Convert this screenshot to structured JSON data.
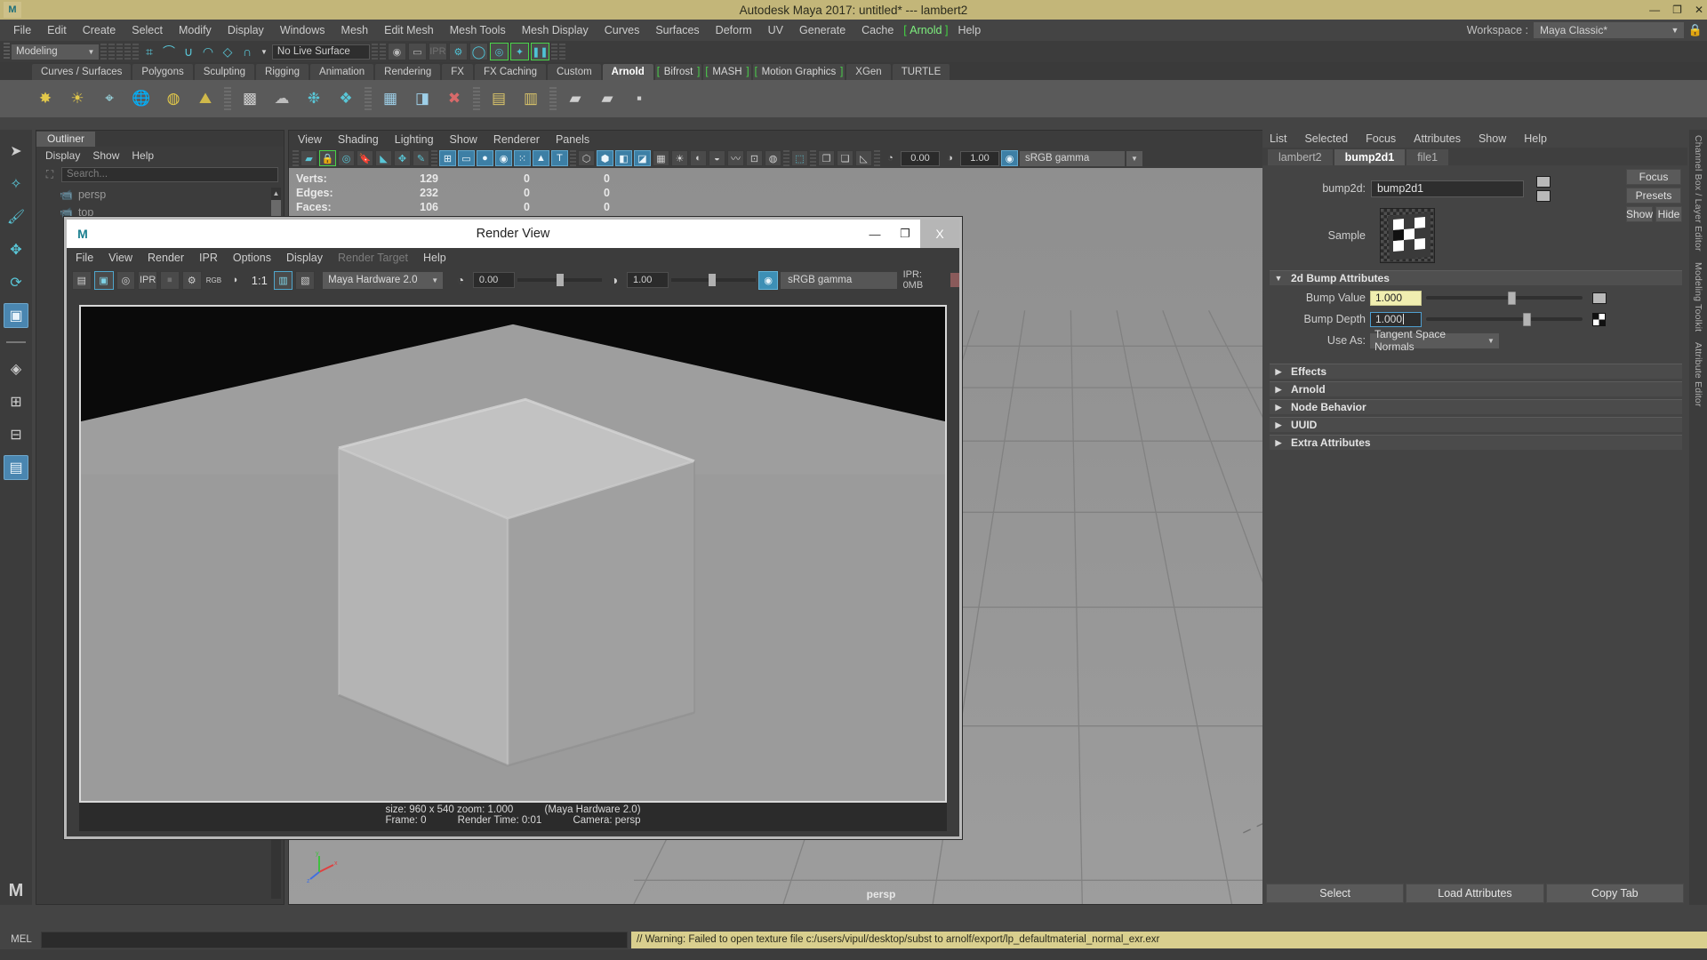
{
  "titlebar": {
    "title": "Autodesk Maya 2017: untitled*   ---   lambert2",
    "logo": "M",
    "minimize": "—",
    "maximize": "❐",
    "close": "✕"
  },
  "menubar": {
    "items": [
      "File",
      "Edit",
      "Create",
      "Select",
      "Modify",
      "Display",
      "Windows",
      "Mesh",
      "Edit Mesh",
      "Mesh Tools",
      "Mesh Display",
      "Curves",
      "Surfaces",
      "Deform",
      "UV",
      "Generate",
      "Cache",
      "Arnold",
      "Help"
    ],
    "highlighted": "Arnold",
    "workspace_label": "Workspace :",
    "workspace_value": "Maya Classic*",
    "lock_icon": "lock-icon"
  },
  "statusline": {
    "mode": "Modeling",
    "live_surface": "No Live Surface",
    "snap_icons": [
      "snap-grid-icon",
      "snap-curve-icon",
      "snap-point-icon",
      "snap-projected-center-icon",
      "snap-view-plane-icon",
      "snap-pivot-icon"
    ],
    "right_icons": [
      "render-current-frame-icon",
      "ipr-render-icon",
      "render-settings-icon",
      "hypershade-icon",
      "render-view-icon",
      "editor-icon",
      "playblast-icon"
    ]
  },
  "shelf": {
    "tabs": [
      {
        "label": "Curves / Surfaces",
        "style": "normal"
      },
      {
        "label": "Polygons",
        "style": "normal"
      },
      {
        "label": "Sculpting",
        "style": "normal"
      },
      {
        "label": "Rigging",
        "style": "normal"
      },
      {
        "label": "Animation",
        "style": "normal"
      },
      {
        "label": "Rendering",
        "style": "normal"
      },
      {
        "label": "FX",
        "style": "normal"
      },
      {
        "label": "FX Caching",
        "style": "normal"
      },
      {
        "label": "Custom",
        "style": "normal"
      },
      {
        "label": "Arnold",
        "style": "active"
      },
      {
        "label": "Bifrost",
        "style": "green"
      },
      {
        "label": "MASH",
        "style": "green"
      },
      {
        "label": "Motion Graphics",
        "style": "green"
      },
      {
        "label": "XGen",
        "style": "normal"
      },
      {
        "label": "TURTLE",
        "style": "normal"
      }
    ]
  },
  "toolbox": {
    "items": [
      {
        "name": "select-tool",
        "glyph": "➤",
        "state": "normal"
      },
      {
        "name": "lasso-select-tool",
        "glyph": "✎",
        "state": "normal"
      },
      {
        "name": "paint-select-tool",
        "glyph": "🖌",
        "state": "normal"
      },
      {
        "name": "move-tool",
        "glyph": "✥",
        "state": "normal"
      },
      {
        "name": "rotate-tool",
        "glyph": "⟳",
        "state": "normal"
      },
      {
        "name": "scale-tool",
        "glyph": "▣",
        "state": "selected"
      },
      {
        "name": "last-tool",
        "glyph": "◆",
        "state": "grey"
      },
      {
        "name": "single-perspective-layout",
        "glyph": "◈",
        "state": "grey"
      },
      {
        "name": "four-view-layout",
        "glyph": "⊞",
        "state": "grey"
      },
      {
        "name": "persp-outliner-layout",
        "glyph": "⊟",
        "state": "grey"
      },
      {
        "name": "hypergraph-layout",
        "glyph": "▤",
        "state": "selected"
      }
    ],
    "maya_mark": "M"
  },
  "outliner": {
    "tab_label": "Outliner",
    "menus": [
      "Display",
      "Show",
      "Help"
    ],
    "search_placeholder": "Search...",
    "search_icon": "search-filter-icon",
    "items": [
      {
        "label": "persp",
        "icon": "camera-icon"
      },
      {
        "label": "top",
        "icon": "camera-icon"
      }
    ]
  },
  "viewport": {
    "menus": [
      "View",
      "Shading",
      "Lighting",
      "Show",
      "Renderer",
      "Panels"
    ],
    "hud": {
      "rows": [
        {
          "label": "Verts:",
          "c1": "129",
          "c2": "0",
          "c3": "0"
        },
        {
          "label": "Edges:",
          "c1": "232",
          "c2": "0",
          "c3": "0"
        },
        {
          "label": "Faces:",
          "c1": "106",
          "c2": "0",
          "c3": "0"
        }
      ]
    },
    "exposure": "0.00",
    "gamma_value": "1.00",
    "color_profile": "sRGB gamma",
    "camera_name": "persp",
    "toolbar_icons": [
      "select-camera-icon",
      "lock-camera-icon",
      "camera-attributes-icon",
      "bookmark-icon",
      "image-plane-icon",
      "two-d-pan-zoom-icon",
      "grease-pencil-icon",
      "grid-icon",
      "film-gate-icon",
      "resolution-gate-icon",
      "gate-mask-icon",
      "xray-icon",
      "xray-joints-icon",
      "texture-icon",
      "wireframe-icon",
      "smooth-shade-icon"
    ]
  },
  "render_view": {
    "title": "Render View",
    "logo": "M",
    "window_buttons": {
      "minimize": "—",
      "maximize": "❐",
      "close": "X"
    },
    "menus": [
      "File",
      "View",
      "Render",
      "IPR",
      "Options",
      "Display",
      "Render Target",
      "Help"
    ],
    "disabled_menu": "Render Target",
    "toolbar": {
      "renderer": "Maya Hardware 2.0",
      "zoom_ratio": "1:1",
      "rgb_label": "RGB",
      "exposure": "0.00",
      "gamma": "1.00",
      "color_profile": "sRGB gamma",
      "ipr_memory": "IPR: 0MB",
      "icons": [
        "redo-render-icon",
        "render-region-icon",
        "snapshot-icon",
        "ipr-render-icon",
        "ipr-stop-icon",
        "render-settings-icon",
        "rgb-channel-icon",
        "alpha-channel-icon",
        "keep-image-icon",
        "remove-image-icon"
      ]
    },
    "status": {
      "size": "size: 960 x 540 zoom: 1.000",
      "renderer": "(Maya Hardware 2.0)",
      "frame": "Frame: 0",
      "render_time": "Render Time: 0:01",
      "camera": "Camera: persp"
    }
  },
  "attribute_editor": {
    "menus": [
      "List",
      "Selected",
      "Focus",
      "Attributes",
      "Show",
      "Help"
    ],
    "tabs": [
      {
        "label": "lambert2",
        "active": false
      },
      {
        "label": "bump2d1",
        "active": true
      },
      {
        "label": "file1",
        "active": false
      }
    ],
    "node_label": "bump2d:",
    "node_name": "bump2d1",
    "side_buttons": [
      "Focus",
      "Presets"
    ],
    "show_button": "Show",
    "hide_button": "Hide",
    "sample_label": "Sample",
    "sections": [
      {
        "title": "2d Bump Attributes",
        "expanded": true
      },
      {
        "title": "Effects",
        "expanded": false
      },
      {
        "title": "Arnold",
        "expanded": false
      },
      {
        "title": "Node Behavior",
        "expanded": false
      },
      {
        "title": "UUID",
        "expanded": false
      },
      {
        "title": "Extra Attributes",
        "expanded": false
      }
    ],
    "bump_value": {
      "label": "Bump Value",
      "value": "1.000",
      "slider_pct": 52
    },
    "bump_depth": {
      "label": "Bump Depth",
      "value": "1.000",
      "slider_pct": 62
    },
    "use_as": {
      "label": "Use As:",
      "value": "Tangent Space Normals"
    },
    "bottom_buttons": [
      "Select",
      "Load Attributes",
      "Copy Tab"
    ]
  },
  "right_tabs": [
    "Channel Box / Layer Editor",
    "Modeling Toolkit",
    "Attribute Editor"
  ],
  "mel": {
    "label": "MEL",
    "input_value": "",
    "warning": "// Warning: Failed to open texture file c:/users/vipul/desktop/subst to arnolf/export/lp_defaultmaterial_normal_exr.exr"
  },
  "colors": {
    "title_bar": "#c3b679",
    "accent_cyan": "#59c7d8",
    "accent_green": "#4ad44a",
    "selected_blue": "#4a86b0",
    "warning_bg": "#d9cf8e",
    "field_yellow": "#f0eeb0"
  }
}
